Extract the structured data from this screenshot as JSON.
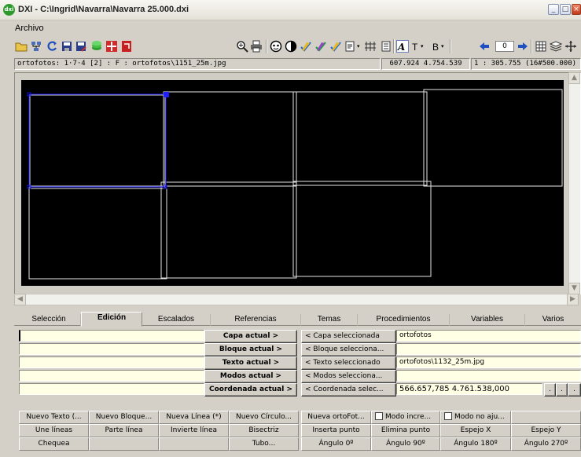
{
  "window": {
    "title": "DXI - C:\\Ingrid\\Navarra\\Navarra 25.000.dxi",
    "app_logo": "dxi"
  },
  "menu": {
    "items": [
      "Archivo"
    ]
  },
  "toolbar": {
    "icons": [
      "open-folder-icon",
      "network-icon",
      "refresh-icon",
      "save-icon",
      "save-as-icon",
      "layers-icon",
      "palette-icon",
      "export-icon",
      "zoom-icon",
      "print-icon",
      "face-icon",
      "contrast-icon",
      "check-pencil-icon",
      "check-pencil-2-icon",
      "check-pencil-3-icon",
      "document-icon",
      "grid-icon",
      "sheet-icon",
      "font-style-icon",
      "text-icon",
      "bold-icon",
      "arrow-left-icon",
      "arrow-right-icon",
      "grid-view-icon",
      "layers-stack-icon",
      "move-icon"
    ],
    "text_t": "T",
    "text_b": "B",
    "page_value": "0"
  },
  "status": {
    "left": "ortofotos: 1·7·4 [2] : F : ortofotos\\1151_25m.jpg",
    "coords": "607.924  4.754.539",
    "scale": "1 : 305.755 (16#500.000)"
  },
  "tabs": [
    "Selección",
    "Edición",
    "Escalados",
    "Referencias",
    "Temas",
    "Procedimientos",
    "Variables",
    "Varios"
  ],
  "active_tab": "Edición",
  "edit_panel": {
    "inputs": [
      "",
      "",
      "",
      "",
      ""
    ],
    "capa_actual": "Capa actual >",
    "bloque_actual": "Bloque actual >",
    "texto_actual": "Texto actual >",
    "modos_actual": "Modos actual >",
    "coordenada_actual": "Coordenada actual >",
    "capa_sel_btn": "< Capa seleccionada",
    "bloque_sel_btn": "< Bloque selecciona...",
    "texto_sel_btn": "< Texto seleccionado",
    "modos_sel_btn": "< Modos selecciona...",
    "coord_sel_btn": "< Coordenada selec...",
    "capa_value": "ortofotos",
    "bloque_value": "",
    "texto_value": "ortofotos\\1132_25m.jpg",
    "modos_value": "",
    "coord_value": "566.657,785 4.761.538,000",
    "dots": [
      ".",
      ".",
      "."
    ]
  },
  "commands": {
    "row1": [
      "Nuevo Texto (...",
      "Nuevo Bloque...",
      "Nueva Línea (*)",
      "Nuevo Círculo...",
      "Nueva ortoFot...",
      "Modo incre...",
      "Modo no aju..."
    ],
    "row2": [
      "Une líneas",
      "Parte línea",
      "Invierte línea",
      "Bisectriz",
      "Inserta punto",
      "Elimina punto",
      "Espejo X",
      "Espejo Y"
    ],
    "row3": [
      "Chequea",
      "",
      "",
      "Tubo...",
      "Ángulo 0º",
      "Ángulo 90º",
      "Ángulo 180º",
      "Ángulo 270º"
    ]
  },
  "chart_data": null
}
